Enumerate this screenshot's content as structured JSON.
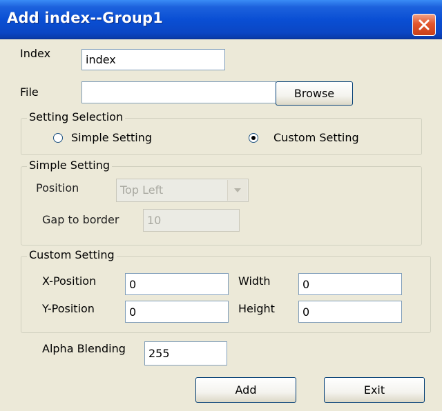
{
  "window": {
    "title": "Add index--Group1",
    "close_icon": "close-x-icon"
  },
  "index": {
    "label": "Index",
    "value": "index"
  },
  "file": {
    "label": "File",
    "value": "",
    "browse_label": "Browse"
  },
  "setting_selection": {
    "title": "Setting Selection",
    "simple_label": "Simple Setting",
    "custom_label": "Custom Setting",
    "selected": "custom"
  },
  "simple_setting": {
    "title": "Simple Setting",
    "position_label": "Position",
    "position_value": "Top Left",
    "gap_label": "Gap to border",
    "gap_value": "10"
  },
  "custom_setting": {
    "title": "Custom Setting",
    "x_label": "X-Position",
    "x_value": "0",
    "y_label": "Y-Position",
    "y_value": "0",
    "width_label": "Width",
    "width_value": "0",
    "height_label": "Height",
    "height_value": "0"
  },
  "alpha": {
    "label": "Alpha Blending",
    "value": "255"
  },
  "buttons": {
    "add": "Add",
    "exit": "Exit"
  },
  "colors": {
    "titlebar": "#0a4fd4",
    "close": "#e2552c",
    "dialog_bg": "#ece9d8"
  }
}
